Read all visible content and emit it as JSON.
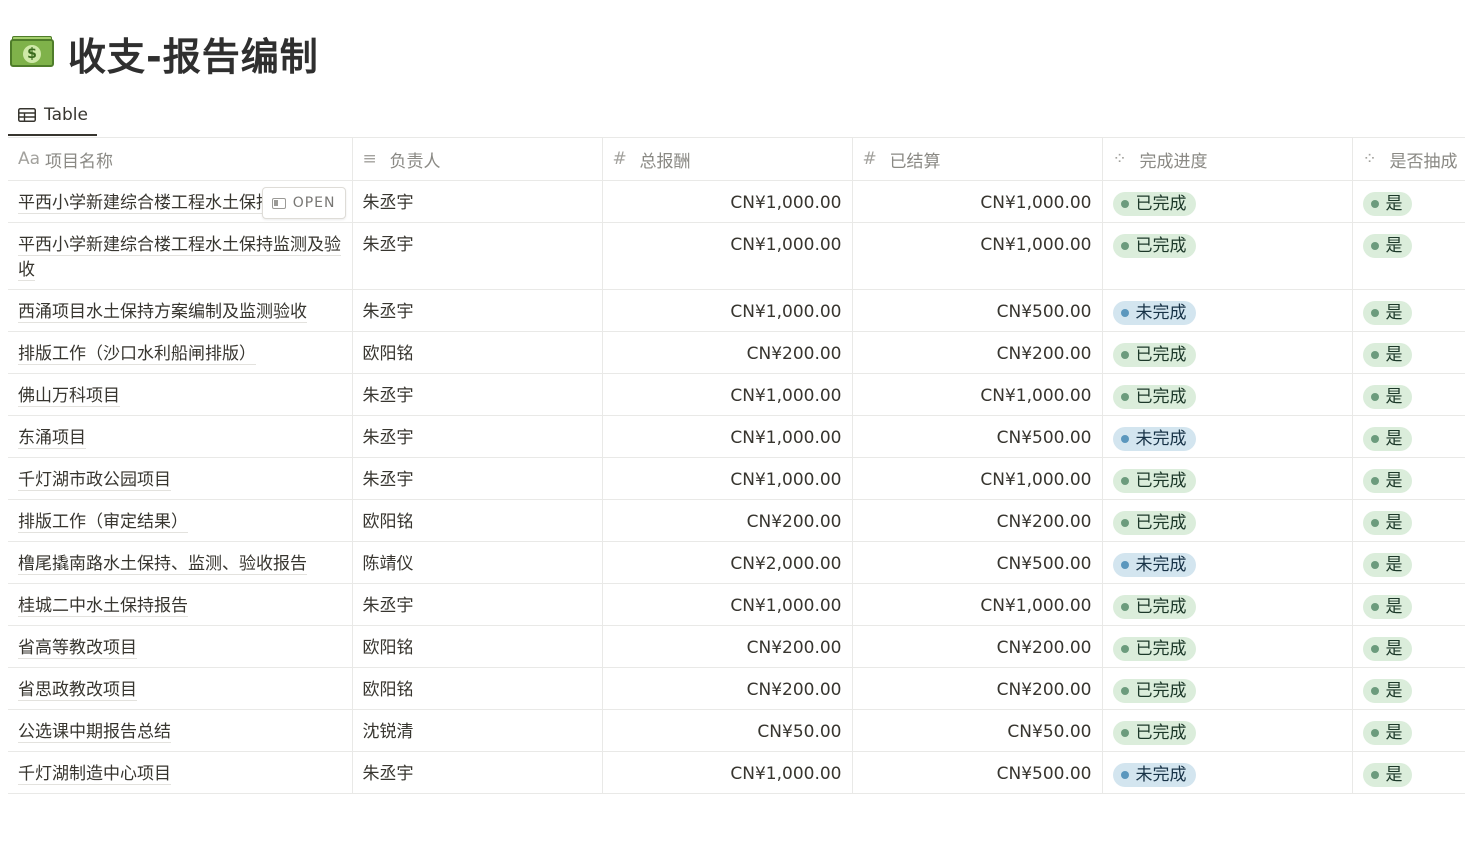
{
  "page": {
    "title": "收支-报告编制",
    "icon": "dollar-banknote-icon",
    "icon_glyph": "$"
  },
  "view": {
    "tab_label": "Table",
    "tab_icon": "table-icon"
  },
  "columns": [
    {
      "label": "项目名称",
      "icon_text": "Aa",
      "icon": "title-type-icon"
    },
    {
      "label": "负责人",
      "icon_text": "≡",
      "icon": "text-type-icon"
    },
    {
      "label": "总报酬",
      "icon_text": "#",
      "icon": "number-type-icon"
    },
    {
      "label": "已结算",
      "icon_text": "#",
      "icon": "number-type-icon"
    },
    {
      "label": "完成进度",
      "icon_text": "⁘",
      "icon": "status-type-icon"
    },
    {
      "label": "是否抽成",
      "icon_text": "⁘",
      "icon": "status-type-icon"
    }
  ],
  "open_button": {
    "label": "OPEN"
  },
  "colors": {
    "done_bg": "#dbeddb",
    "done_dot": "#6c9b7d",
    "todo_bg": "#d3e5ef",
    "todo_dot": "#5b97bd"
  },
  "rows": [
    {
      "name": "平西小学新建综合楼工程水土保持报告书",
      "owner": "朱丞宇",
      "total": "CN¥1,000.00",
      "settled": "CN¥1,000.00",
      "progress": "已完成",
      "progress_color": "green",
      "commission": "是"
    },
    {
      "name": "平西小学新建综合楼工程水土保持监测及验收",
      "owner": "朱丞宇",
      "total": "CN¥1,000.00",
      "settled": "CN¥1,000.00",
      "progress": "已完成",
      "progress_color": "green",
      "commission": "是"
    },
    {
      "name": "西涌项目水土保持方案编制及监测验收",
      "owner": "朱丞宇",
      "total": "CN¥1,000.00",
      "settled": "CN¥500.00",
      "progress": "未完成",
      "progress_color": "blue",
      "commission": "是"
    },
    {
      "name": "排版工作（沙口水利船闸排版）",
      "owner": "欧阳铭",
      "total": "CN¥200.00",
      "settled": "CN¥200.00",
      "progress": "已完成",
      "progress_color": "green",
      "commission": "是"
    },
    {
      "name": "佛山万科项目",
      "owner": "朱丞宇",
      "total": "CN¥1,000.00",
      "settled": "CN¥1,000.00",
      "progress": "已完成",
      "progress_color": "green",
      "commission": "是"
    },
    {
      "name": "东涌项目",
      "owner": "朱丞宇",
      "total": "CN¥1,000.00",
      "settled": "CN¥500.00",
      "progress": "未完成",
      "progress_color": "blue",
      "commission": "是"
    },
    {
      "name": "千灯湖市政公园项目",
      "owner": "朱丞宇",
      "total": "CN¥1,000.00",
      "settled": "CN¥1,000.00",
      "progress": "已完成",
      "progress_color": "green",
      "commission": "是"
    },
    {
      "name": "排版工作（审定结果）",
      "owner": "欧阳铭",
      "total": "CN¥200.00",
      "settled": "CN¥200.00",
      "progress": "已完成",
      "progress_color": "green",
      "commission": "是"
    },
    {
      "name": "橹尾撬南路水土保持、监测、验收报告",
      "owner": "陈靖仪",
      "total": "CN¥2,000.00",
      "settled": "CN¥500.00",
      "progress": "未完成",
      "progress_color": "blue",
      "commission": "是"
    },
    {
      "name": "桂城二中水土保持报告",
      "owner": "朱丞宇",
      "total": "CN¥1,000.00",
      "settled": "CN¥1,000.00",
      "progress": "已完成",
      "progress_color": "green",
      "commission": "是"
    },
    {
      "name": "省高等教改项目",
      "owner": "欧阳铭",
      "total": "CN¥200.00",
      "settled": "CN¥200.00",
      "progress": "已完成",
      "progress_color": "green",
      "commission": "是"
    },
    {
      "name": "省思政教改项目",
      "owner": "欧阳铭",
      "total": "CN¥200.00",
      "settled": "CN¥200.00",
      "progress": "已完成",
      "progress_color": "green",
      "commission": "是"
    },
    {
      "name": "公选课中期报告总结",
      "owner": "沈锐清",
      "total": "CN¥50.00",
      "settled": "CN¥50.00",
      "progress": "已完成",
      "progress_color": "green",
      "commission": "是"
    },
    {
      "name": "千灯湖制造中心项目",
      "owner": "朱丞宇",
      "total": "CN¥1,000.00",
      "settled": "CN¥500.00",
      "progress": "未完成",
      "progress_color": "blue",
      "commission": "是"
    }
  ]
}
